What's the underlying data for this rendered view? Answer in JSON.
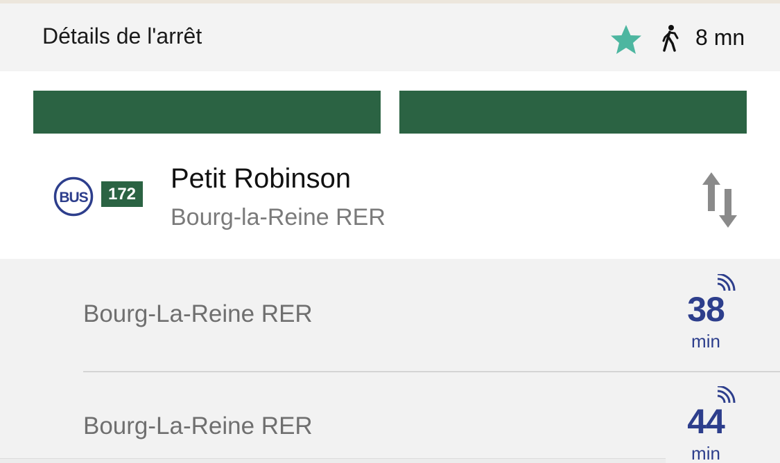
{
  "header": {
    "title": "Détails de l'arrêt",
    "walk_time": "8 mn",
    "favorite_icon": "star-icon",
    "walk_icon": "walking-person-icon",
    "favorite_color": "#4db6a0"
  },
  "stop": {
    "mode_icon": "bus-icon",
    "mode_label": "BUS",
    "line_number": "172",
    "name": "Petit Robinson",
    "direction": "Bourg-la-Reine RER",
    "swap_icon": "swap-direction-icon"
  },
  "departures": [
    {
      "destination": "Bourg-La-Reine RER",
      "minutes": "38",
      "unit": "min",
      "realtime": true
    },
    {
      "destination": "Bourg-La-Reine RER",
      "minutes": "44",
      "unit": "min",
      "realtime": true
    }
  ],
  "colors": {
    "line_green": "#2b6343",
    "ratp_blue": "#2d3e8c",
    "star_teal": "#4db6a0"
  }
}
